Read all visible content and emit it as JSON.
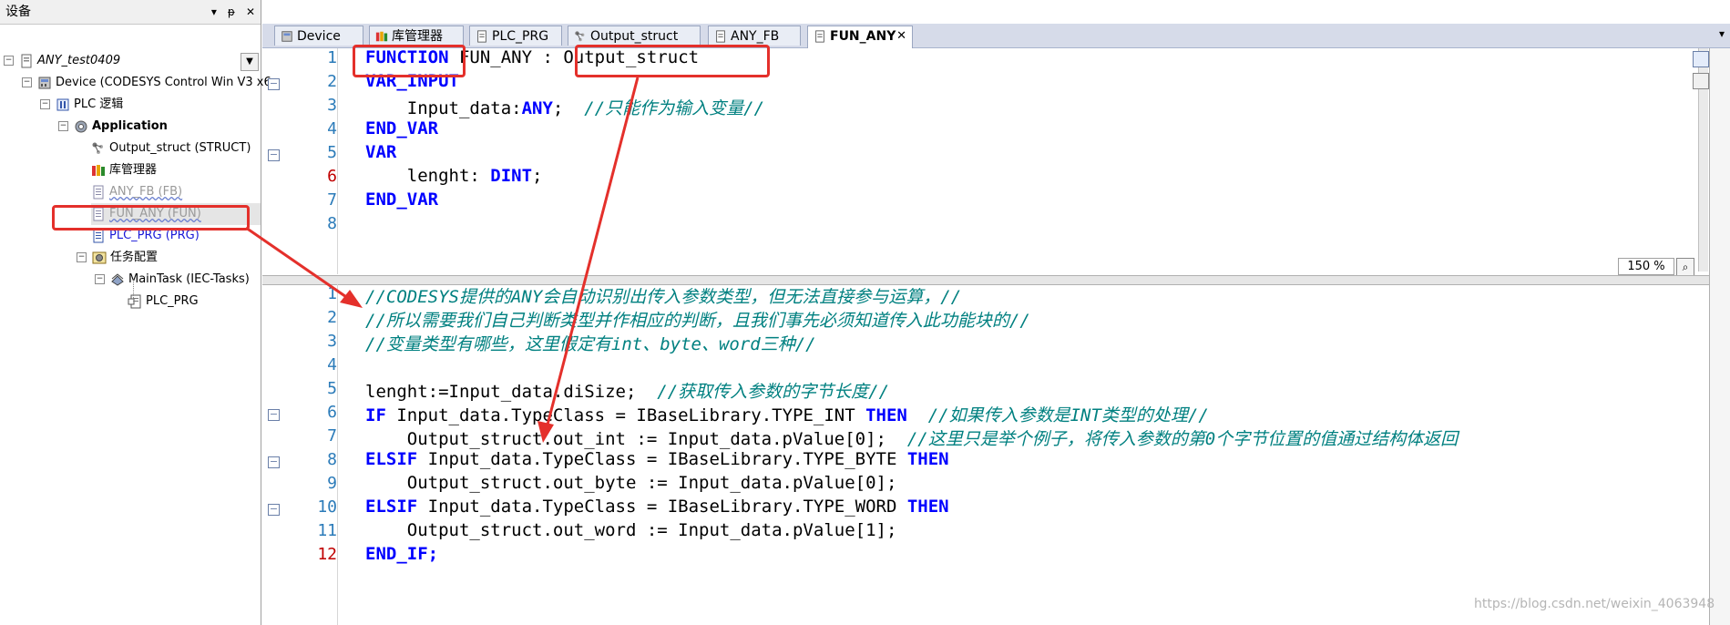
{
  "devices_panel": {
    "title": "设备",
    "tools": [
      "▾",
      "ᵽ",
      "✕"
    ],
    "project": "ANY_test0409",
    "tree": [
      {
        "label": "ANY_test0409",
        "level": 0,
        "icon": "project-icon",
        "expander": "-",
        "italic": true
      },
      {
        "label": "Device (CODESYS Control Win V3 x6",
        "level": 1,
        "icon": "device-icon",
        "expander": "-"
      },
      {
        "label": "PLC 逻辑",
        "level": 2,
        "icon": "plc-logic-icon",
        "expander": "-"
      },
      {
        "label": "Application",
        "level": 3,
        "icon": "application-gear-icon",
        "expander": "-",
        "bold": true
      },
      {
        "label": "Output_struct (STRUCT)",
        "level": 4,
        "icon": "struct-icon"
      },
      {
        "label": "库管理器",
        "level": 4,
        "icon": "library-manager-icon"
      },
      {
        "label": "ANY_FB (FB)",
        "level": 4,
        "icon": "pou-icon",
        "muted": true
      },
      {
        "label": "FUN_ANY (FUN)",
        "level": 4,
        "icon": "pou-icon",
        "muted": true,
        "selected": true
      },
      {
        "label": "PLC_PRG (PRG)",
        "level": 4,
        "icon": "pou-icon",
        "link": true
      },
      {
        "label": "任务配置",
        "level": 4,
        "icon": "task-config-icon",
        "expander": "-"
      },
      {
        "label": "MainTask (IEC-Tasks)",
        "level": 5,
        "icon": "task-icon",
        "expander": "-"
      },
      {
        "label": "PLC_PRG",
        "level": 6,
        "icon": "program-call-icon"
      }
    ]
  },
  "tabs": [
    {
      "label": "Device",
      "icon": "device-icon"
    },
    {
      "label": "库管理器",
      "icon": "library-manager-icon"
    },
    {
      "label": "PLC_PRG",
      "icon": "pou-icon"
    },
    {
      "label": "Output_struct",
      "icon": "struct-icon"
    },
    {
      "label": "ANY_FB",
      "icon": "pou-icon"
    },
    {
      "label": "FUN_ANY",
      "icon": "pou-icon",
      "active": true,
      "close": "✕"
    }
  ],
  "tab_overflow": "▾",
  "declaration": {
    "lines": [
      {
        "no": "1"
      },
      {
        "no": "2"
      },
      {
        "no": "3"
      },
      {
        "no": "4"
      },
      {
        "no": "5"
      },
      {
        "no": "6",
        "modified": true
      },
      {
        "no": "7"
      },
      {
        "no": "8"
      }
    ],
    "code": {
      "l1_kw": "FUNCTION",
      "l1_name": " FUN_ANY : ",
      "l1_type": "Output_struct",
      "l2": "VAR_INPUT",
      "l3_var": "    Input_data:",
      "l3_type": "ANY",
      "l3_semi": ";  ",
      "l3_comment": "//只能作为输入变量//",
      "l4": "END_VAR",
      "l5": "VAR",
      "l6_var": "    lenght: ",
      "l6_type": "DINT",
      "l6_semi": ";",
      "l7": "END_VAR"
    },
    "zoom": "150 %"
  },
  "implementation": {
    "lines": [
      {
        "no": "1"
      },
      {
        "no": "2"
      },
      {
        "no": "3"
      },
      {
        "no": "4"
      },
      {
        "no": "5"
      },
      {
        "no": "6"
      },
      {
        "no": "7"
      },
      {
        "no": "8"
      },
      {
        "no": "9"
      },
      {
        "no": "10"
      },
      {
        "no": "11"
      },
      {
        "no": "12",
        "modified": true
      }
    ],
    "code": {
      "c1": "//CODESYS提供的ANY会自动识别出传入参数类型，但无法直接参与运算，//",
      "c2": "//所以需要我们自己判断类型并作相应的判断，且我们事先必须知道传入此功能块的//",
      "c3": "//变量类型有哪些，这里假定有int、byte、word三种//",
      "l5_code": "lenght:=Input_data.diSize;  ",
      "l5_comment": "//获取传入参数的字节长度//",
      "l6_if": "IF",
      "l6_code": " Input_data.TypeClass = IBaseLibrary.TYPE_INT ",
      "l6_then": "THEN",
      "l6_comment": "  //如果传入参数是INT类型的处理//",
      "l7_code": "    Output_struct.out_int := Input_data.pValue[0];  ",
      "l7_comment": "//这里只是举个例子，将传入参数的第0个字节位置的值通过结构体返回",
      "l8_elsif": "ELSIF",
      "l8_code": " Input_data.TypeClass = IBaseLibrary.TYPE_BYTE ",
      "l8_then": "THEN",
      "l9_code": "    Output_struct.out_byte := Input_data.pValue[0];",
      "l10_elsif": "ELSIF",
      "l10_code": " Input_data.TypeClass = IBaseLibrary.TYPE_WORD ",
      "l10_then": "THEN",
      "l11_code": "    Output_struct.out_word := Input_data.pValue[1];",
      "l12": "END_IF;"
    }
  },
  "fold_glyph": "−",
  "watermark": "https://blog.csdn.net/weixin_4063948",
  "colors": {
    "annotation_red": "#e4302b",
    "keyword_blue": "#0000ff",
    "comment_teal": "#008080",
    "line_number_blue": "#2b7bb9",
    "line_modified_red": "#c00000"
  }
}
